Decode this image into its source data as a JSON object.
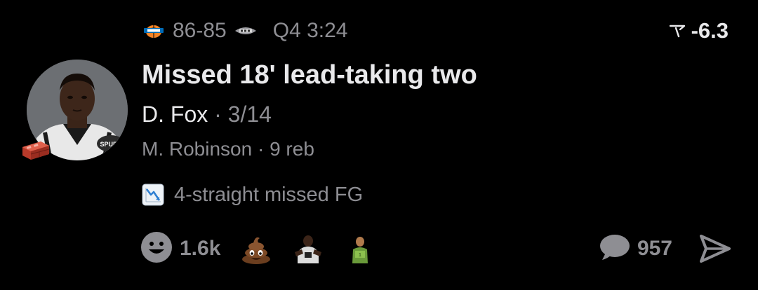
{
  "game": {
    "home_team_icon": "knicks-logo-icon",
    "away_team_icon": "spurs-logo-icon",
    "score": "86-85",
    "clock": "Q4 3:24",
    "spread_icon": "line-movement-icon",
    "spread": "-6.3"
  },
  "play": {
    "avatar_icon": "player-headshot",
    "badge_icon": "brick-icon",
    "title": "Missed 18' lead-taking two",
    "player": "D. Fox",
    "separator": "·",
    "player_stat": "3/14",
    "assist_player": "M. Robinson",
    "assist_stat": "9 reb",
    "streak_icon": "chart-decreasing-icon",
    "streak_text": "4-straight missed FG"
  },
  "engagement": {
    "reaction_icon": "smiley-icon",
    "reaction_count": "1.6k",
    "reaction_emojis": [
      "poop-emoji",
      "player-gif-1",
      "player-gif-2"
    ],
    "comment_icon": "speech-bubble-icon",
    "comment_count": "957",
    "share_icon": "send-icon"
  },
  "colors": {
    "background": "#000000",
    "primary_text": "#e9e9eb",
    "secondary_text": "#8e8e93",
    "knicks_orange": "#f58426",
    "knicks_blue": "#006bb6",
    "brick_red": "#c0392b"
  }
}
